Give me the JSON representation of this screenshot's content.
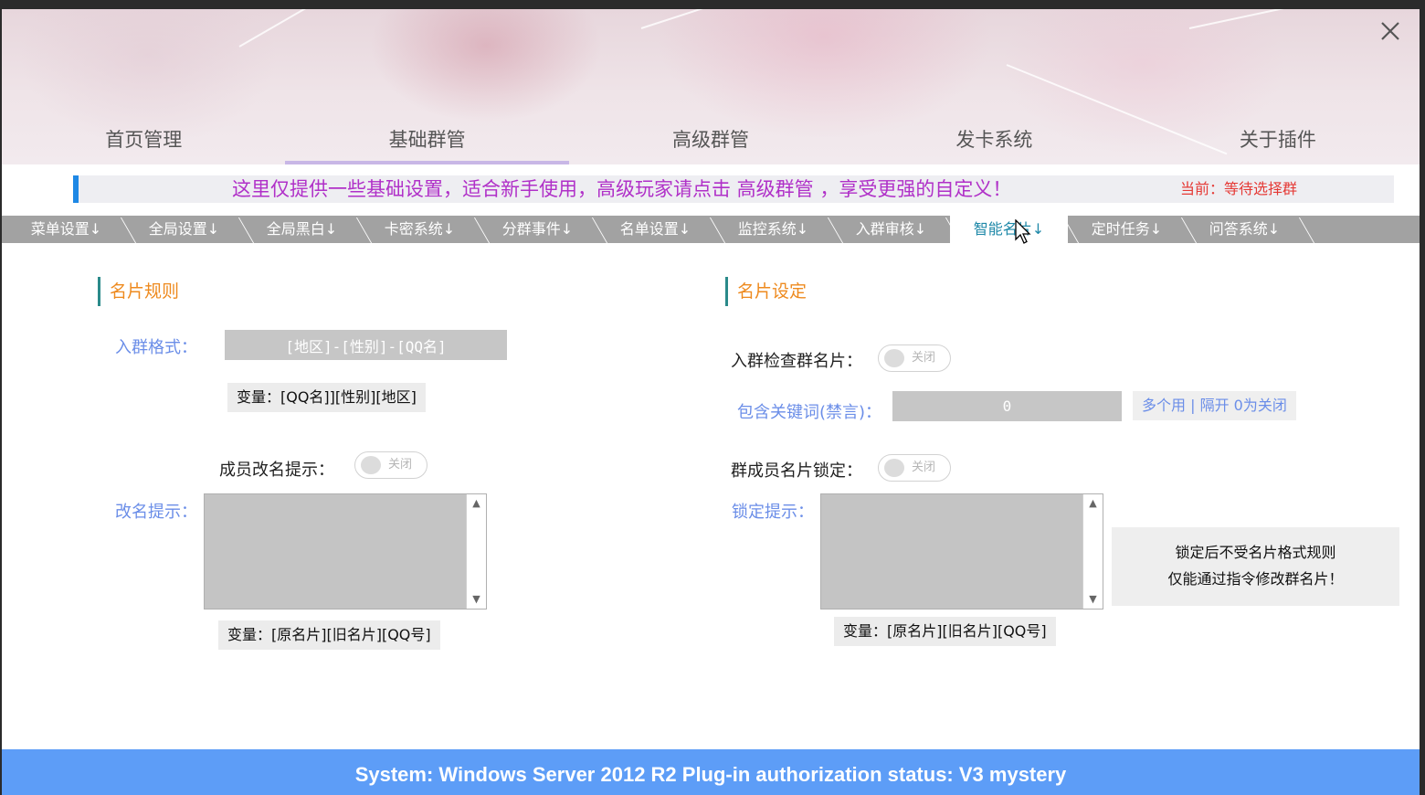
{
  "nav": {
    "items": [
      "首页管理",
      "基础群管",
      "高级群管",
      "发卡系统",
      "关于插件"
    ],
    "active_index": 1
  },
  "notice": {
    "text": "这里仅提供一些基础设置，适合新手使用，高级玩家请点击 高级群管 ，享受更强的自定义！",
    "current": "当前：等待选择群"
  },
  "subtabs": {
    "items": [
      "菜单设置↓",
      "全局设置↓",
      "全局黑白↓",
      "卡密系统↓",
      "分群事件↓",
      "名单设置↓",
      "监控系统↓",
      "入群审核↓",
      "智能名片↓",
      "定时任务↓",
      "问答系统↓"
    ],
    "active_index": 8
  },
  "left": {
    "title": "名片规则",
    "join_format_label": "入群格式：",
    "join_format_value": "[地区]-[性别]-[QQ名]",
    "join_format_vars": "变量：[QQ名]][性别][地区]",
    "rename_notice_label": "成员改名提示：",
    "rename_notice_toggle": "关闭",
    "rename_hint_label": "改名提示：",
    "rename_hint_value": "",
    "rename_vars": "变量：[原名片][旧名片][QQ号]"
  },
  "right": {
    "title": "名片设定",
    "check_card_label": "入群检查群名片：",
    "check_card_toggle": "关闭",
    "keywords_label": "包含关键词(禁言)：",
    "keywords_value": "0",
    "keywords_hint": "多个用 | 隔开 0为关闭",
    "lock_label": "群成员名片锁定：",
    "lock_toggle": "关闭",
    "lock_hint_label": "锁定提示：",
    "lock_hint_value": "",
    "lock_vars": "变量：[原名片][旧名片][QQ号]",
    "lock_info_line1": "锁定后不受名片格式规则",
    "lock_info_line2": "仅能通过指令修改群名片！"
  },
  "footer": {
    "text": "System:  Windows Server 2012 R2  Plug-in authorization status:  V3 mystery"
  },
  "colors": {
    "accent_blue": "#1e88e5",
    "notice_purple": "#b030c8",
    "notice_red": "#e53935",
    "section_orange": "#ee8a1e",
    "label_blue": "#6b8ee8",
    "footer_blue": "#5d9df7",
    "subtab_gray": "#a2a2a2"
  }
}
